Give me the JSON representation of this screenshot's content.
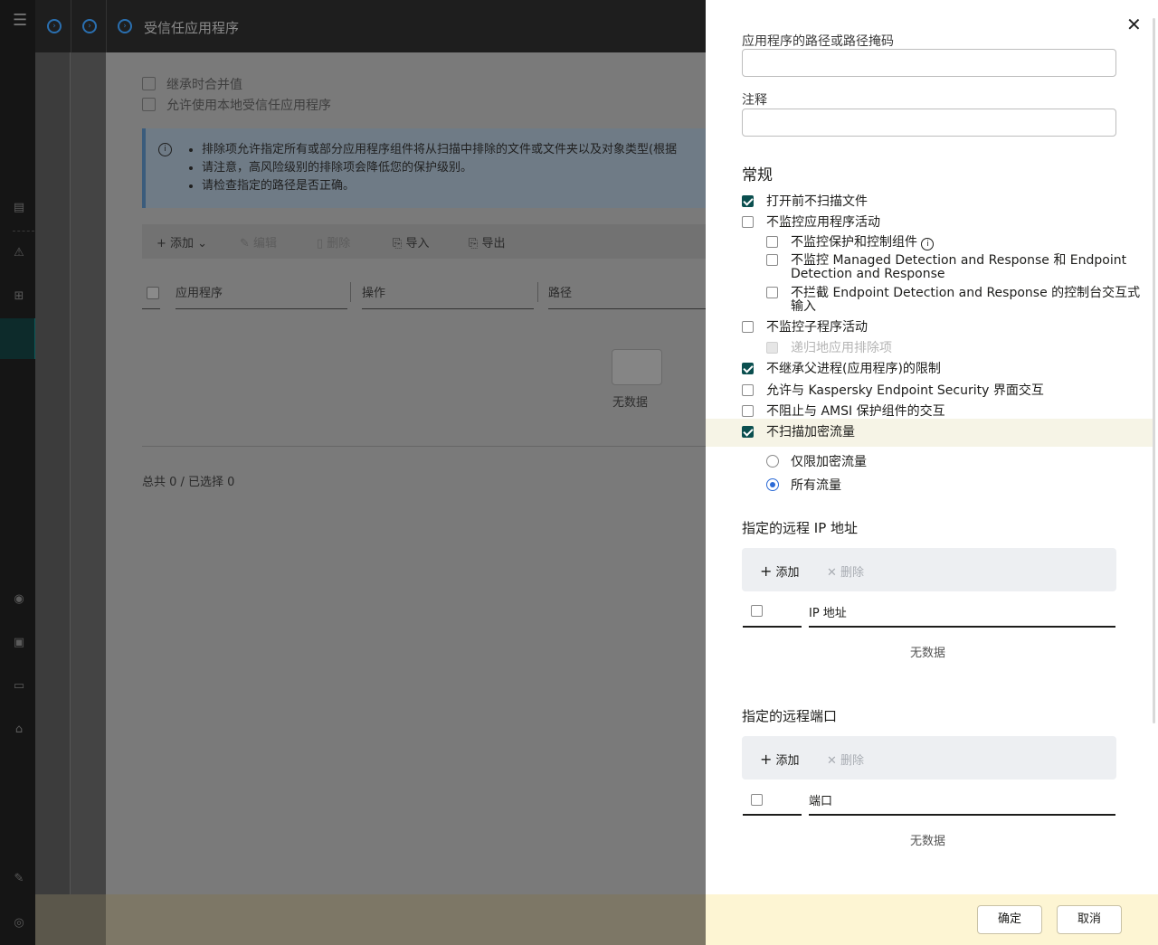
{
  "topbar": {
    "title": "受信任应用程序"
  },
  "main": {
    "checkboxes": [
      "继承时合并值",
      "允许使用本地受信任应用程序"
    ],
    "info": [
      "排除项允许指定所有或部分应用程序组件将从扫描中排除的文件或文件夹以及对象类型(根据",
      "请注意，高风险级别的排除项会降低您的保护级别。",
      "请检查指定的路径是否正确。"
    ],
    "toolbar": {
      "add": "+ 添加",
      "edit": "编辑",
      "delete": "删除",
      "import": "导入",
      "export": "导出"
    },
    "columns": [
      "应用程序",
      "操作",
      "路径"
    ],
    "empty": "无数据",
    "total": "总共 0 / 已选择 0"
  },
  "drawer": {
    "path_label": "应用程序的路径或路径掩码",
    "path_value": "",
    "comment_label": "注释",
    "comment_value": "",
    "general_title": "常规",
    "options": {
      "no_scan_open": "打开前不扫描文件",
      "no_monitor_app": "不监控应用程序活动",
      "no_monitor_protect": "不监控保护和控制组件",
      "no_monitor_mdr_1": "不监控 Managed Detection and Response 和 Endpoint",
      "no_monitor_mdr_2": "Detection and Response",
      "no_block_edr_1": "不拦截 Endpoint Detection and Response 的控制台交互式",
      "no_block_edr_2": "输入",
      "no_monitor_child": "不监控子程序活动",
      "recursive": "递归地应用排除项",
      "no_inherit": "不继承父进程(应用程序)的限制",
      "allow_kes": "允许与 Kaspersky Endpoint Security 界面交互",
      "no_block_amsi": "不阻止与 AMSI 保护组件的交互",
      "no_scan_encrypted": "不扫描加密流量",
      "only_encrypted": "仅限加密流量",
      "all_traffic": "所有流量"
    },
    "ip": {
      "title": "指定的远程 IP 地址",
      "add": "添加",
      "delete": "删除",
      "column": "IP 地址",
      "empty": "无数据"
    },
    "port": {
      "title": "指定的远程端口",
      "add": "添加",
      "delete": "删除",
      "column": "端口",
      "empty": "无数据"
    },
    "ok": "确定",
    "cancel": "取消"
  }
}
